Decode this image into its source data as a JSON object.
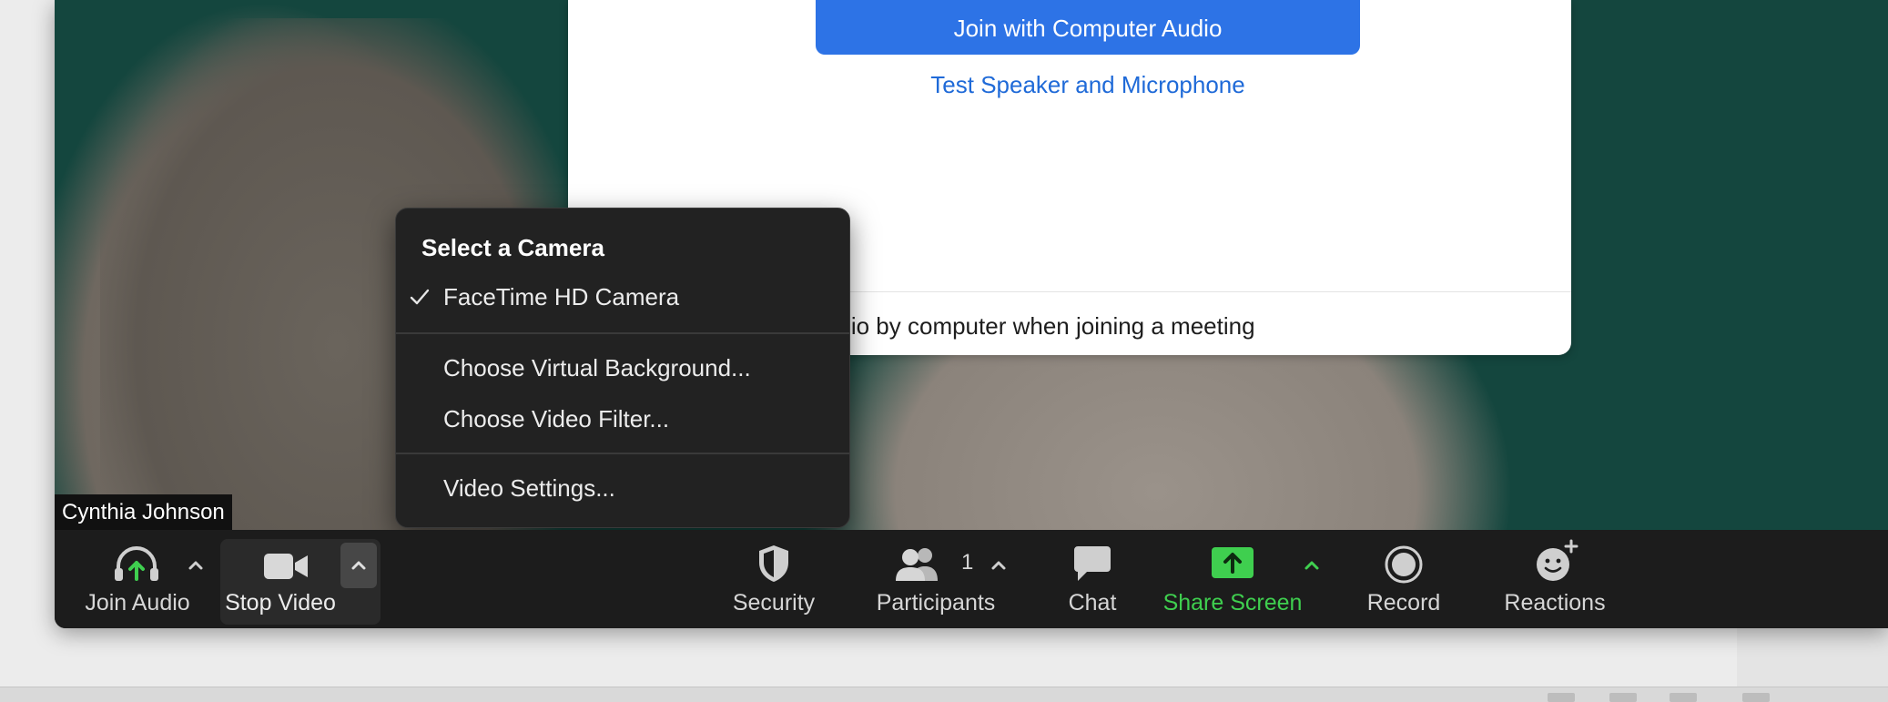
{
  "audio_dialog": {
    "join_button": "Join with Computer Audio",
    "test_link": "Test Speaker and Microphone",
    "auto_join_text": "in audio by computer when joining a meeting"
  },
  "video": {
    "participant_name": "Cynthia Johnson"
  },
  "camera_menu": {
    "title": "Select a Camera",
    "camera_option": "FaceTime HD Camera",
    "virtual_background": "Choose Virtual Background...",
    "video_filter": "Choose Video Filter...",
    "video_settings": "Video Settings..."
  },
  "toolbar": {
    "join_audio": "Join Audio",
    "stop_video": "Stop Video",
    "security": "Security",
    "participants": "Participants",
    "participants_count": "1",
    "chat": "Chat",
    "share_screen": "Share Screen",
    "record": "Record",
    "reactions": "Reactions"
  },
  "colors": {
    "accent_blue": "#2d73e6",
    "share_green": "#3fcf4f",
    "toolbar_bg": "#1c1c1c"
  }
}
